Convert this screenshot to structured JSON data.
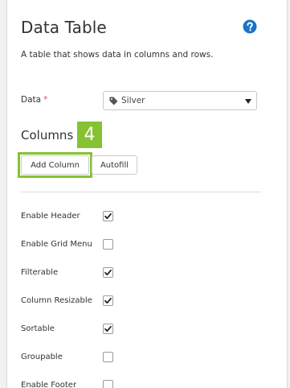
{
  "panel": {
    "title": "Data Table",
    "description": "A table that shows data in columns and rows."
  },
  "data_field": {
    "label": "Data",
    "required_marker": "*",
    "value": "Silver",
    "icon": "tag-icon"
  },
  "columns": {
    "heading": "Columns",
    "step_badge": "4",
    "add_column_label": "Add Column",
    "autofill_label": "Autofill"
  },
  "options": [
    {
      "label": "Enable Header",
      "checked": true
    },
    {
      "label": "Enable Grid Menu",
      "checked": false
    },
    {
      "label": "Filterable",
      "checked": true
    },
    {
      "label": "Column Resizable",
      "checked": true
    },
    {
      "label": "Sortable",
      "checked": true
    },
    {
      "label": "Groupable",
      "checked": false
    },
    {
      "label": "Enable Footer",
      "checked": false
    }
  ],
  "colors": {
    "accent_green": "#86c232",
    "help_blue": "#1a73c8",
    "required_red": "#d9534f"
  }
}
